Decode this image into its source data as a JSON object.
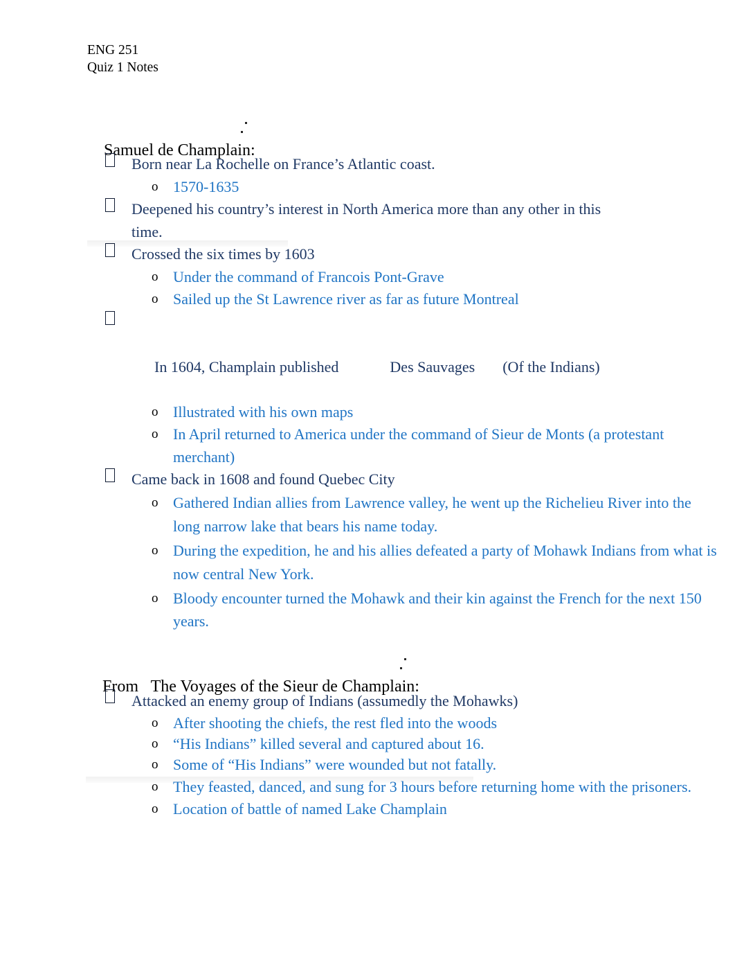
{
  "document": {
    "course": "ENG 251",
    "subtitle": "Quiz 1 Notes"
  },
  "colors": {
    "level1_text": "#1F3864",
    "level2_text": "#1F74C4",
    "heading_text": "#000000",
    "marker_o": "#000000",
    "page_background": "#FFFFFF"
  },
  "sections": [
    {
      "heading": "Samuel de Champlain:",
      "items": [
        {
          "level": 1,
          "marker": "missing-glyph-box",
          "text": "Born near La Rochelle on France’s Atlantic coast."
        },
        {
          "level": 2,
          "marker": "o",
          "text": "1570-1635"
        },
        {
          "level": 1,
          "marker": "missing-glyph-box",
          "text": "Deepened his country’s interest in North America more than any other in this time."
        },
        {
          "level": 1,
          "marker": "missing-glyph-box",
          "text": "Crossed the six times by 1603"
        },
        {
          "level": 2,
          "marker": "o",
          "text": "Under the command of Francois Pont-Grave"
        },
        {
          "level": 2,
          "marker": "o",
          "text": "Sailed up the St Lawrence river as far as future Montreal"
        },
        {
          "level": 1,
          "marker": "missing-glyph-box",
          "published_prefix": "In 1604, Champlain published",
          "published_title": "Des Sauvages",
          "published_translation": "(Of the Indians)"
        },
        {
          "level": 2,
          "marker": "o",
          "text": "Illustrated with his own maps"
        },
        {
          "level": 2,
          "marker": "o",
          "text": "In April returned to America under the command of Sieur de Monts (a protestant merchant)"
        },
        {
          "level": 1,
          "marker": "missing-glyph-box",
          "text": "Came back in 1608 and found Quebec City"
        },
        {
          "level": 2,
          "marker": "o",
          "text": "Gathered Indian allies from Lawrence valley, he went up the Richelieu River into the long narrow lake that bears his name today."
        },
        {
          "level": 2,
          "marker": "o",
          "text": "During the expedition, he and his allies defeated a party of Mohawk Indians from what is now central New York."
        },
        {
          "level": 2,
          "marker": "o",
          "text": "Bloody encounter turned the Mohawk and their kin against the French for the next 150 years."
        }
      ]
    },
    {
      "heading": "From   The Voyages of the Sieur de Champlain:",
      "items": [
        {
          "level": 1,
          "marker": "missing-glyph-box",
          "text": "Attacked an enemy group of Indians (assumedly the Mohawks)"
        },
        {
          "level": 2,
          "marker": "o",
          "text": "After shooting the chiefs, the rest fled into the woods"
        },
        {
          "level": 2,
          "marker": "o",
          "text": "“His Indians” killed several and captured about 16."
        },
        {
          "level": 2,
          "marker": "o",
          "text": "Some of “His Indians” were wounded but not fatally."
        },
        {
          "level": 2,
          "marker": "o",
          "text": "They feasted, danced, and sung for 3 hours before returning home with the prisoners."
        },
        {
          "level": 2,
          "marker": "o",
          "text": "Location of battle of named Lake Champlain"
        }
      ]
    }
  ]
}
